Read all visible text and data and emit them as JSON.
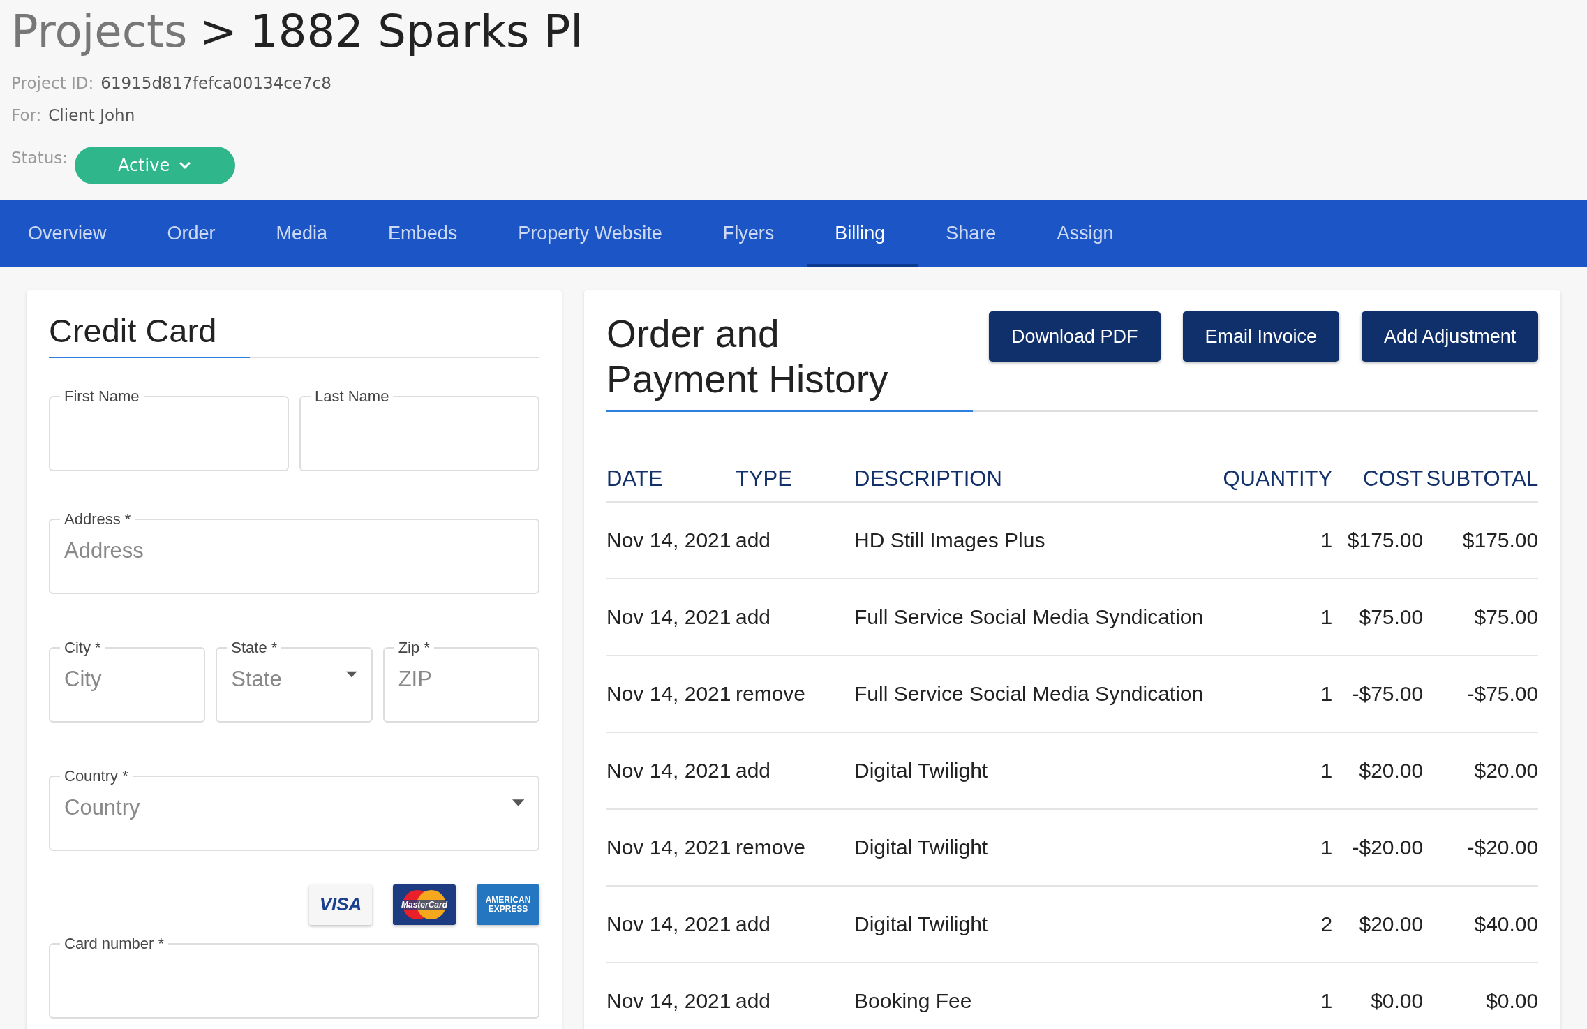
{
  "breadcrumb": {
    "parent": "Projects",
    "separator": ">",
    "current": "1882 Sparks Pl"
  },
  "meta": [
    {
      "label": "Project ID:",
      "value": "61915d817fefca00134ce7c8"
    },
    {
      "label": "For:",
      "value": "Client John"
    }
  ],
  "status": {
    "label": "Status:",
    "value": "Active"
  },
  "tabs": [
    {
      "label": "Overview",
      "selected": false
    },
    {
      "label": "Order",
      "selected": false
    },
    {
      "label": "Media",
      "selected": false
    },
    {
      "label": "Embeds",
      "selected": false
    },
    {
      "label": "Property Website",
      "selected": false
    },
    {
      "label": "Flyers",
      "selected": false
    },
    {
      "label": "Billing",
      "selected": true
    },
    {
      "label": "Share",
      "selected": false
    },
    {
      "label": "Assign",
      "selected": false
    }
  ],
  "credit_card": {
    "title": "Credit Card",
    "name_fields": [
      {
        "label": "First Name"
      },
      {
        "label": "Last Name"
      }
    ],
    "address": {
      "label": "Address *",
      "placeholder": "Address"
    },
    "location_fields": [
      {
        "kind": "text",
        "label": "City *",
        "placeholder": "City"
      },
      {
        "kind": "select",
        "label": "State *",
        "placeholder": "State"
      },
      {
        "kind": "text",
        "label": "Zip *",
        "placeholder": "ZIP"
      }
    ],
    "country": {
      "label": "Country *",
      "placeholder": "Country"
    },
    "cards": [
      {
        "kind": "visa",
        "lines": [
          "VISA"
        ]
      },
      {
        "kind": "mastercard",
        "lines": [
          "MasterCard"
        ]
      },
      {
        "kind": "amex",
        "lines": [
          "AMERICAN",
          "EXPRESS"
        ]
      }
    ],
    "card_number": {
      "label": "Card number *"
    }
  },
  "history": {
    "title_lines": [
      "Order and",
      "Payment History"
    ],
    "buttons": [
      "Download PDF",
      "Email Invoice",
      "Add Adjustment"
    ],
    "columns": [
      "DATE",
      "TYPE",
      "DESCRIPTION",
      "QUANTITY",
      "COST",
      "SUBTOTAL"
    ],
    "rows": [
      [
        "Nov 14, 2021",
        "add",
        "HD Still Images Plus",
        "1",
        "$175.00",
        "$175.00"
      ],
      [
        "Nov 14, 2021",
        "add",
        "Full Service Social Media Syndication",
        "1",
        "$75.00",
        "$75.00"
      ],
      [
        "Nov 14, 2021",
        "remove",
        "Full Service Social Media Syndication",
        "1",
        "-$75.00",
        "-$75.00"
      ],
      [
        "Nov 14, 2021",
        "add",
        "Digital Twilight",
        "1",
        "$20.00",
        "$20.00"
      ],
      [
        "Nov 14, 2021",
        "remove",
        "Digital Twilight",
        "1",
        "-$20.00",
        "-$20.00"
      ],
      [
        "Nov 14, 2021",
        "add",
        "Digital Twilight",
        "2",
        "$20.00",
        "$40.00"
      ],
      [
        "Nov 14, 2021",
        "add",
        "Booking Fee",
        "1",
        "$0.00",
        "$0.00"
      ]
    ]
  }
}
